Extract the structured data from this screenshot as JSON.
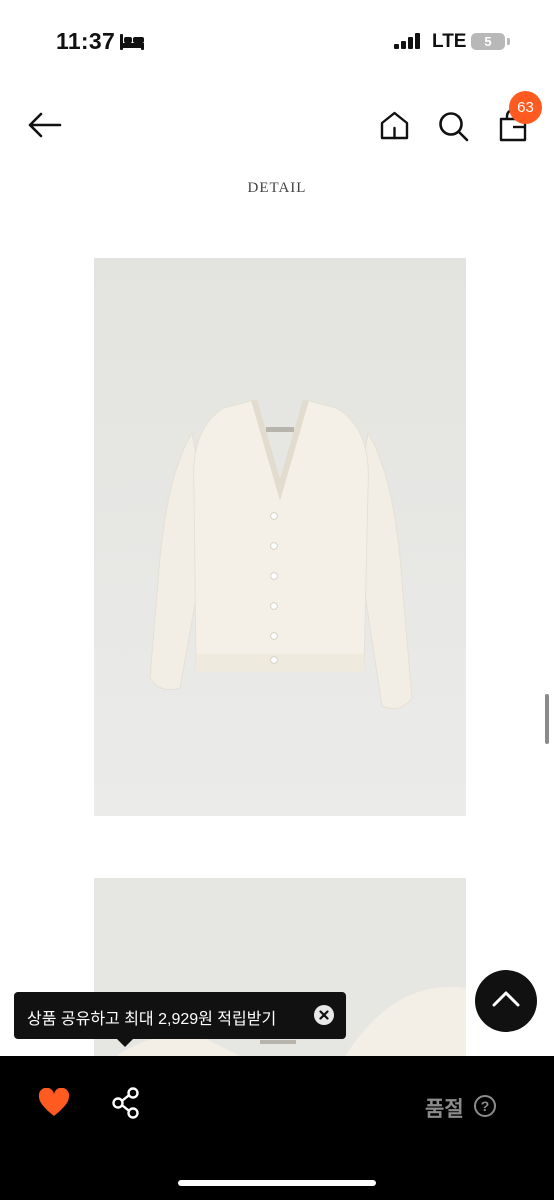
{
  "status_bar": {
    "time": "11:37",
    "network": "LTE",
    "battery": "5"
  },
  "nav": {
    "cart_badge": "63"
  },
  "detail": {
    "title": "DETAIL"
  },
  "tooltip": {
    "text": "상품 공유하고 최대 2,929원 적립받기"
  },
  "bottom_bar": {
    "status": "품절",
    "help": "?"
  },
  "colors": {
    "accent": "#ff5a1f",
    "heart": "#ff5a1f",
    "bar": "#000000"
  },
  "icons": [
    "bed-icon",
    "signal-icon",
    "back-arrow-icon",
    "home-icon",
    "search-icon",
    "shopping-bag-icon",
    "chevron-up-icon",
    "close-icon",
    "heart-icon",
    "share-icon",
    "help-icon"
  ]
}
